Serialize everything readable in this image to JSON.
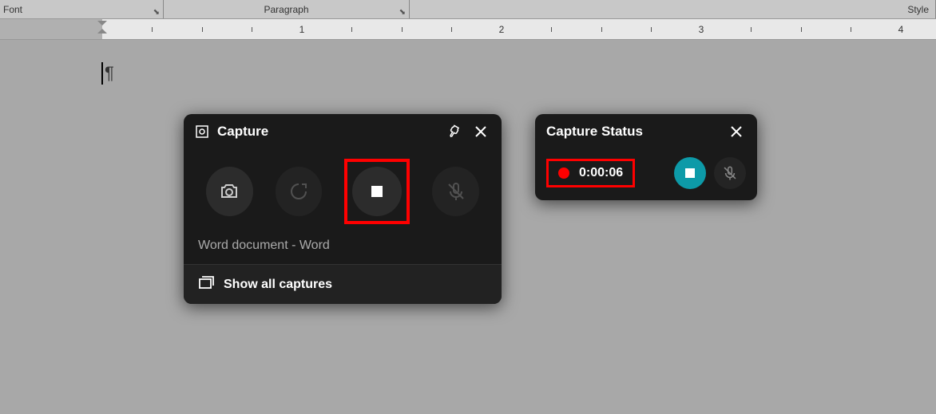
{
  "ribbon": {
    "font_label": "Font",
    "paragraph_label": "Paragraph",
    "style_label": "Style"
  },
  "ruler": {
    "numbers": [
      "1",
      "2",
      "3",
      "4"
    ]
  },
  "document": {
    "pilcrow": "¶"
  },
  "capture_panel": {
    "title": "Capture",
    "target_window": "Word document - Word",
    "footer_label": "Show all captures",
    "icons": {
      "screenshot": "camera-icon",
      "last30": "refresh-icon",
      "stop": "stop-icon",
      "mic_off": "mic-off-icon",
      "pin": "pin-icon",
      "close": "close-icon",
      "gallery": "gallery-icon",
      "capture_logo": "capture-logo-icon"
    }
  },
  "status_panel": {
    "title": "Capture Status",
    "timer": "0:00:06",
    "icons": {
      "close": "close-icon",
      "recording": "recording-dot",
      "stop": "stop-icon",
      "mic_off": "mic-off-icon"
    }
  },
  "colors": {
    "accent_teal": "#0d9aa8",
    "highlight_red": "#ff0000",
    "panel_bg": "#1a1a1a"
  }
}
